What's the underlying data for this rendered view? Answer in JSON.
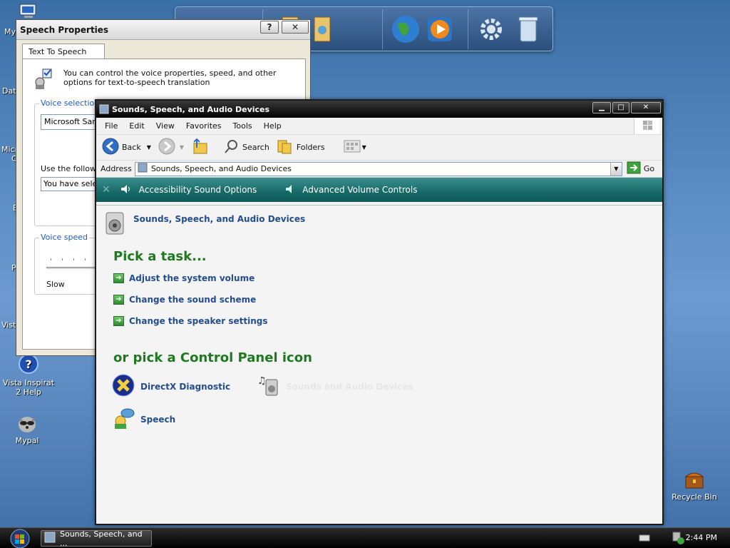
{
  "desktop": {
    "icons": [
      {
        "label": "Vista Inspirat 2 Help"
      },
      {
        "label": "Mypal"
      },
      {
        "label": "Recycle Bin"
      }
    ],
    "partial_labels": [
      "My",
      "Dat",
      "Micr",
      "C",
      "E",
      "P",
      "Vista"
    ]
  },
  "speech_window": {
    "title": "Speech Properties",
    "help_btn": "?",
    "close_btn": "✕",
    "tab": "Text To Speech",
    "intro": "You can control the voice properties, speed, and other options for text-to-speech translation",
    "voice_selection_label": "Voice selection",
    "voice_value": "Microsoft Sam",
    "use_following": "Use the followin",
    "preview_text": "You have selec",
    "voice_speed_label": "Voice speed",
    "slow_label": "Slow"
  },
  "sound_window": {
    "title": "Sounds, Speech, and Audio Devices",
    "menu": [
      "File",
      "Edit",
      "View",
      "Favorites",
      "Tools",
      "Help"
    ],
    "toolbar": {
      "back": "Back",
      "search": "Search",
      "folders": "Folders"
    },
    "address_label": "Address",
    "address_value": "Sounds, Speech, and Audio Devices",
    "go": "Go",
    "teal_links": [
      "Accessibility Sound Options",
      "Advanced Volume Controls"
    ],
    "header_title": "Sounds, Speech, and Audio Devices",
    "pick_task": "Pick a task...",
    "tasks": [
      "Adjust the system volume",
      "Change the sound scheme",
      "Change the speaker settings"
    ],
    "pick_icon": "or pick a Control Panel icon",
    "icons": [
      {
        "label": "DirectX Diagnostic"
      },
      {
        "label": "Sounds and Audio Devices"
      },
      {
        "label": "Speech"
      }
    ]
  },
  "taskbar": {
    "task_button": "Sounds, Speech, and ...",
    "clock": "2:44 PM"
  }
}
